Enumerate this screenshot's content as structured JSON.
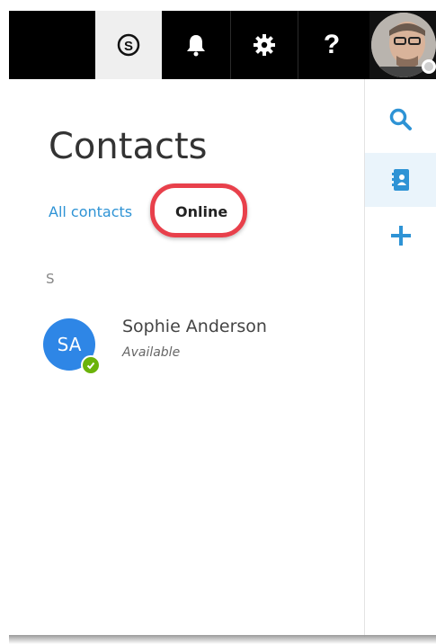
{
  "header": {
    "skype_icon": "skype-logo-icon",
    "notifications_icon": "bell-icon",
    "settings_icon": "gear-icon",
    "help_label": "?"
  },
  "main": {
    "title": "Contacts",
    "tabs": [
      {
        "label": "All contacts",
        "selected": false
      },
      {
        "label": "Online",
        "selected": true
      }
    ],
    "section_letter": "S",
    "contacts": [
      {
        "initials": "SA",
        "name": "Sophie Anderson",
        "status": "Available"
      }
    ]
  },
  "rail": {
    "icons": [
      "search-icon",
      "contacts-book-icon",
      "add-icon"
    ]
  },
  "colors": {
    "accent": "#2e93d5",
    "highlight": "#e8404b",
    "presence_available": "#6bb30a",
    "avatar_bg": "#2e86e6"
  }
}
